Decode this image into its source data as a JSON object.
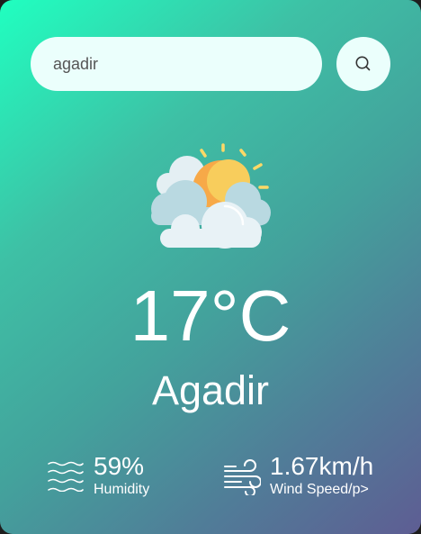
{
  "search": {
    "value": "agadir",
    "icon": "search-icon"
  },
  "weather": {
    "icon": "partly-cloudy-icon",
    "temperature": "17°C",
    "city": "Agadir"
  },
  "humidity": {
    "icon": "humidity-waves-icon",
    "value": "59%",
    "label": "Humidity"
  },
  "wind": {
    "icon": "wind-icon",
    "value": "1.67km/h",
    "label": "Wind Speed/p>"
  },
  "colors": {
    "gradient_start": "#20ffc0",
    "gradient_end": "#5e5d93",
    "search_background": "#ebfffc",
    "sun": "#f7a948"
  }
}
